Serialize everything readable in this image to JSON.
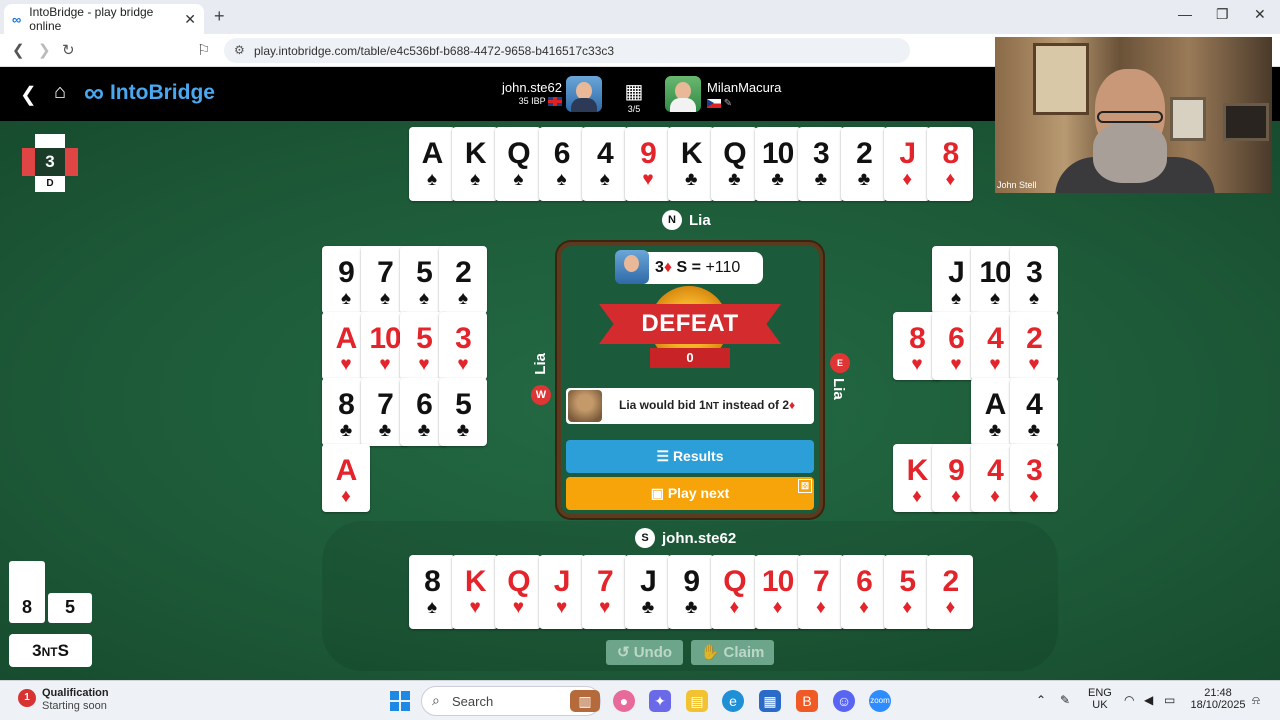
{
  "browser": {
    "tab_title": "IntoBridge - play bridge online",
    "url": "play.intobridge.com/table/e4c536bf-b688-4472-9658-b416517c33c3",
    "ext_badge": "3"
  },
  "app": {
    "logo": "IntoBridge",
    "player_you": {
      "name": "john.ste62",
      "ibp": "35 IBP"
    },
    "board_counter": "3/5",
    "opponent": {
      "name": "MilanMacura"
    }
  },
  "contract_marker": {
    "level": "3",
    "declarer": "D"
  },
  "north": {
    "seat": "N",
    "name": "Lia",
    "cards": [
      {
        "rank": "A",
        "suit": "♠",
        "color": "black"
      },
      {
        "rank": "K",
        "suit": "♠",
        "color": "black"
      },
      {
        "rank": "Q",
        "suit": "♠",
        "color": "black"
      },
      {
        "rank": "6",
        "suit": "♠",
        "color": "black"
      },
      {
        "rank": "4",
        "suit": "♠",
        "color": "black"
      },
      {
        "rank": "9",
        "suit": "♥",
        "color": "red"
      },
      {
        "rank": "K",
        "suit": "♣",
        "color": "black"
      },
      {
        "rank": "Q",
        "suit": "♣",
        "color": "black"
      },
      {
        "rank": "10",
        "suit": "♣",
        "color": "black"
      },
      {
        "rank": "3",
        "suit": "♣",
        "color": "black"
      },
      {
        "rank": "2",
        "suit": "♣",
        "color": "black"
      },
      {
        "rank": "J",
        "suit": "♦",
        "color": "red"
      },
      {
        "rank": "8",
        "suit": "♦",
        "color": "red"
      }
    ]
  },
  "west": {
    "seat": "W",
    "name": "Lia",
    "rows": [
      [
        {
          "rank": "9",
          "suit": "♠",
          "color": "black"
        },
        {
          "rank": "7",
          "suit": "♠",
          "color": "black"
        },
        {
          "rank": "5",
          "suit": "♠",
          "color": "black"
        },
        {
          "rank": "2",
          "suit": "♠",
          "color": "black"
        }
      ],
      [
        {
          "rank": "A",
          "suit": "♥",
          "color": "red"
        },
        {
          "rank": "10",
          "suit": "♥",
          "color": "red"
        },
        {
          "rank": "5",
          "suit": "♥",
          "color": "red"
        },
        {
          "rank": "3",
          "suit": "♥",
          "color": "red"
        }
      ],
      [
        {
          "rank": "8",
          "suit": "♣",
          "color": "black"
        },
        {
          "rank": "7",
          "suit": "♣",
          "color": "black"
        },
        {
          "rank": "6",
          "suit": "♣",
          "color": "black"
        },
        {
          "rank": "5",
          "suit": "♣",
          "color": "black"
        }
      ],
      [
        {
          "rank": "A",
          "suit": "♦",
          "color": "red"
        }
      ]
    ]
  },
  "east": {
    "seat": "E",
    "name": "Lia",
    "rows": [
      [
        {
          "rank": "J",
          "suit": "♠",
          "color": "black"
        },
        {
          "rank": "10",
          "suit": "♠",
          "color": "black"
        },
        {
          "rank": "3",
          "suit": "♠",
          "color": "black"
        }
      ],
      [
        {
          "rank": "8",
          "suit": "♥",
          "color": "red"
        },
        {
          "rank": "6",
          "suit": "♥",
          "color": "red"
        },
        {
          "rank": "4",
          "suit": "♥",
          "color": "red"
        },
        {
          "rank": "2",
          "suit": "♥",
          "color": "red"
        }
      ],
      [
        {
          "rank": "A",
          "suit": "♣",
          "color": "black"
        },
        {
          "rank": "4",
          "suit": "♣",
          "color": "black"
        }
      ],
      [
        {
          "rank": "K",
          "suit": "♦",
          "color": "red"
        },
        {
          "rank": "9",
          "suit": "♦",
          "color": "red"
        },
        {
          "rank": "4",
          "suit": "♦",
          "color": "red"
        },
        {
          "rank": "3",
          "suit": "♦",
          "color": "red"
        }
      ]
    ]
  },
  "south": {
    "seat": "S",
    "name": "john.ste62",
    "cards": [
      {
        "rank": "8",
        "suit": "♠",
        "color": "black"
      },
      {
        "rank": "K",
        "suit": "♥",
        "color": "red"
      },
      {
        "rank": "Q",
        "suit": "♥",
        "color": "red"
      },
      {
        "rank": "J",
        "suit": "♥",
        "color": "red"
      },
      {
        "rank": "7",
        "suit": "♥",
        "color": "red"
      },
      {
        "rank": "J",
        "suit": "♣",
        "color": "black"
      },
      {
        "rank": "9",
        "suit": "♣",
        "color": "black"
      },
      {
        "rank": "Q",
        "suit": "♦",
        "color": "red"
      },
      {
        "rank": "10",
        "suit": "♦",
        "color": "red"
      },
      {
        "rank": "7",
        "suit": "♦",
        "color": "red"
      },
      {
        "rank": "6",
        "suit": "♦",
        "color": "red"
      },
      {
        "rank": "5",
        "suit": "♦",
        "color": "red"
      },
      {
        "rank": "2",
        "suit": "♦",
        "color": "red"
      }
    ]
  },
  "result": {
    "contract_level": "3",
    "contract_suit": "♦",
    "declarer": "S",
    "result_sign": "=",
    "points": "+110",
    "banner": "DEFEAT",
    "score": "0",
    "hint_prefix": "Lia would bid 1",
    "hint_nt": "NT",
    "hint_mid": " instead of 2",
    "hint_suit": "♦",
    "results_label": "Results",
    "play_next_label": "Play next"
  },
  "tricks": {
    "ns": "8",
    "ew": "5"
  },
  "final_bid": {
    "level": "3",
    "strain": "NT",
    "declarer": "S"
  },
  "actions": {
    "undo": "Undo",
    "claim": "Claim"
  },
  "webcam": {
    "label": "John Stell"
  },
  "taskbar": {
    "notice_badge": "1",
    "notice_title": "Qualification",
    "notice_sub": "Starting soon",
    "search": "Search",
    "lang1": "ENG",
    "lang2": "UK",
    "time": "21:48",
    "date": "18/10/2025"
  },
  "colors": {
    "felt": "#1f5a3b",
    "red_suit": "#e3242b",
    "results": "#2d9fd8",
    "play_next": "#f7a30a",
    "defeat": "#d42b2f"
  }
}
